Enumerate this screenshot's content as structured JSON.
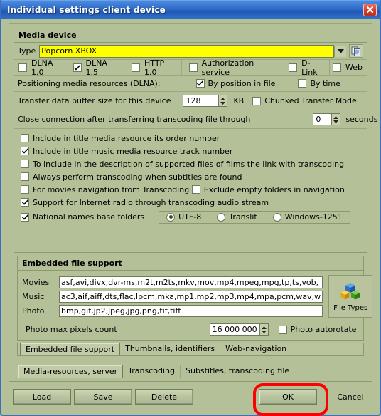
{
  "window": {
    "title": "Individual settings client device",
    "close_icon": "close-icon"
  },
  "media_device": {
    "group_title": "Media device",
    "type_label": "Type",
    "type_value": "Popcorn XBOX",
    "type_dropdown_icon": "chevron-down-icon",
    "copy_icon": "copy-document-icon",
    "protocols": [
      {
        "label": "DLNA 1.0",
        "checked": false
      },
      {
        "label": "DLNA 1.5",
        "checked": true
      },
      {
        "label": "HTTP 1.0",
        "checked": false
      },
      {
        "label": "Authorization service",
        "checked": false
      },
      {
        "label": "D-Link",
        "checked": false
      },
      {
        "label": "Web",
        "checked": false
      }
    ],
    "positioning_label": "Positioning media resources (DLNA):",
    "positioning_options": [
      {
        "label": "By position in file",
        "checked": true
      },
      {
        "label": "By time",
        "checked": false
      }
    ],
    "buffer_label": "Transfer data buffer size for this device",
    "buffer_value": "128",
    "buffer_unit": "KB",
    "chunked_label": "Chunked Transfer Mode",
    "chunked_checked": false,
    "close_conn_label": "Close connection after transferring transcoding file through",
    "close_conn_value": "0",
    "close_conn_unit": "seconds",
    "options": [
      {
        "label": "Include in title media resource its order number",
        "checked": false
      },
      {
        "label": "Include in title music media resource track number",
        "checked": true
      },
      {
        "label": "To include in the description of supported files of films the link with transcoding",
        "checked": false
      },
      {
        "label": "Always perform transcoding when subtitles are found",
        "checked": false
      },
      {
        "label": "For movies navigation from Transcoding",
        "checked": false
      },
      {
        "label": "Exclude empty folders in navigation",
        "checked": false
      },
      {
        "label": "Support for Internet radio through transcoding audio stream",
        "checked": true
      }
    ],
    "national_names_label": "National names base folders",
    "national_names_checked": true,
    "encodings": [
      {
        "label": "UTF-8",
        "selected": true
      },
      {
        "label": "Translit",
        "selected": false
      },
      {
        "label": "Windows-1251",
        "selected": false
      }
    ]
  },
  "embedded": {
    "group_title": "Embedded file support",
    "movies_label": "Movies",
    "movies_value": "asf,avi,divx,dvr-ms,m2t,m2ts,mkv,mov,mp4,mpeg,mpg,tp,ts,vob,",
    "music_label": "Music",
    "music_value": "ac3,aif,aiff,dts,flac,lpcm,mka,mp1,mp2,mp3,mp4,mpa,pcm,wav,w",
    "photo_label": "Photo",
    "photo_value": "bmp,gif,jp2,jpeg,jpg,png,tif,tiff",
    "file_types_button": "File Types",
    "file_types_icon": "cubes-icon",
    "photo_max_label": "Photo max pixels count",
    "photo_max_value": "16 000 000",
    "photo_autorotate_label": "Photo autorotate",
    "photo_autorotate_checked": false
  },
  "inner_tabs": [
    {
      "label": "Embedded file support",
      "selected": true
    },
    {
      "label": "Thumbnails, identifiers",
      "selected": false
    },
    {
      "label": "Web-navigation",
      "selected": false
    }
  ],
  "outer_tabs": [
    {
      "label": "Media-resources, server",
      "selected": true
    },
    {
      "label": "Transcoding",
      "selected": false
    },
    {
      "label": "Substitles, transcoding file",
      "selected": false
    }
  ],
  "buttons": {
    "load": "Load",
    "save": "Save",
    "delete": "Delete",
    "ok": "OK",
    "cancel": "Cancel"
  },
  "colors": {
    "background": "#b4c098",
    "titlebar": "#2e6cc8",
    "highlight_field": "#ffff00",
    "annotation": "#ff0000"
  }
}
